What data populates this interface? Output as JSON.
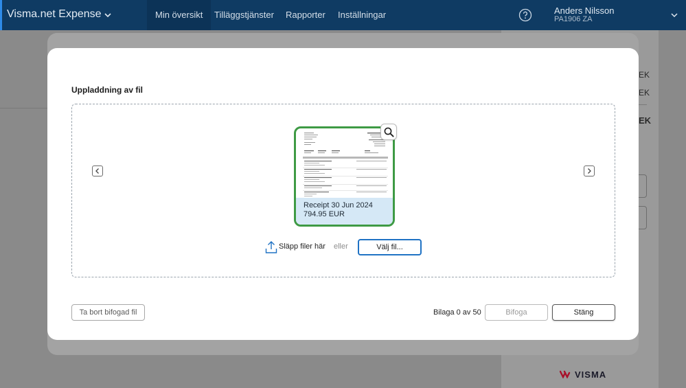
{
  "app": {
    "brand": "Visma.net Expense",
    "nav": [
      "Min översikt",
      "Tilläggstjänster",
      "Rapporter",
      "Inställningar"
    ],
    "user_name": "Anders Nilsson",
    "user_id": "PA1906 ZA"
  },
  "background": {
    "currency_rows": [
      "EK",
      "EK"
    ],
    "currency_bold": "EK",
    "logo": "VISMA"
  },
  "modal": {
    "title": "Uppladdning av fil",
    "file": {
      "name": "Receipt 30 Jun 2024",
      "amount": "794.95 EUR"
    },
    "drop_label": "Släpp filer här",
    "or_label": "eller",
    "choose_label": "Välj fil...",
    "remove_label": "Ta bort bifogad fil",
    "attachment_count": "Bilaga 0 av 50",
    "attach_label": "Bifoga",
    "close_label": "Stäng"
  },
  "colors": {
    "topbar": "#0f3b63",
    "accent": "#2e8be8",
    "selected_border": "#3e9a44",
    "primary_outline": "#1f72c4"
  },
  "icons": [
    "chevron-down-icon",
    "help-icon",
    "chevron-left-icon",
    "chevron-right-icon",
    "search-icon",
    "upload-icon",
    "visma-logo-icon"
  ]
}
